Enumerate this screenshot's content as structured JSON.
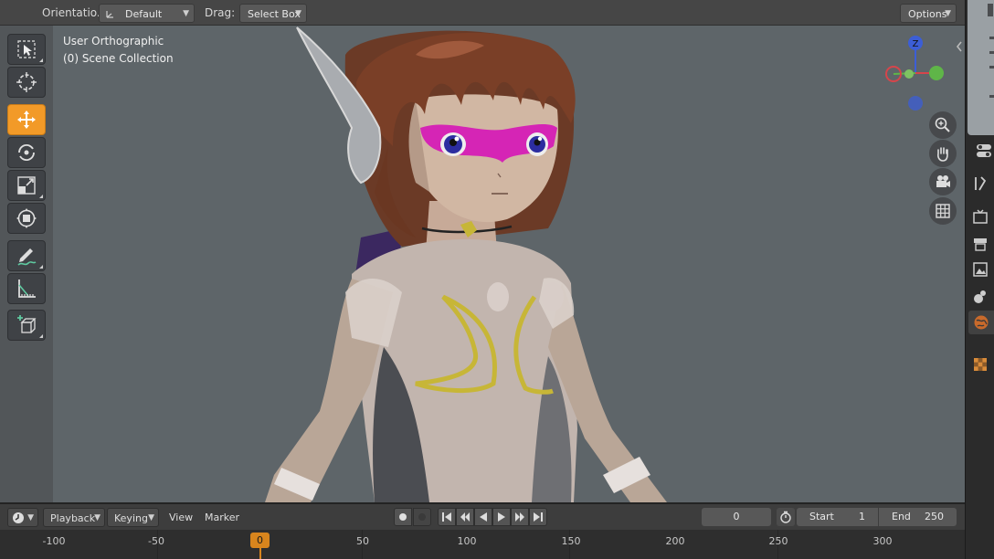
{
  "header": {
    "orientation_label": "Orientatio...",
    "orientation_value": "Default",
    "drag_label": "Drag:",
    "drag_value": "Select Box",
    "options_label": "Options"
  },
  "viewport": {
    "view_name": "User Orthographic",
    "collection": "(0) Scene Collection"
  },
  "gizmo": {
    "x_label": "X",
    "y_label": "Y",
    "z_label": "Z"
  },
  "toolbar": {
    "tools": [
      "select-box",
      "cursor",
      "move",
      "rotate",
      "scale",
      "transform",
      "annotate",
      "measure",
      "add-cube"
    ],
    "active_tool": "move"
  },
  "timeline": {
    "playback_label": "Playback",
    "keying_label": "Keying",
    "view_label": "View",
    "marker_label": "Marker",
    "current_frame": "0",
    "start_label": "Start",
    "start_value": "1",
    "end_label": "End",
    "end_value": "250",
    "playhead_frame": "0",
    "ruler_ticks": [
      "-100",
      "-50",
      "50",
      "100",
      "150",
      "200",
      "250",
      "300"
    ]
  },
  "colors": {
    "accent": "#f29a28",
    "viewport_bg": "#5e6569",
    "axis_x": "#d6454b",
    "axis_y": "#5fb548",
    "axis_z": "#3c5ed6"
  }
}
